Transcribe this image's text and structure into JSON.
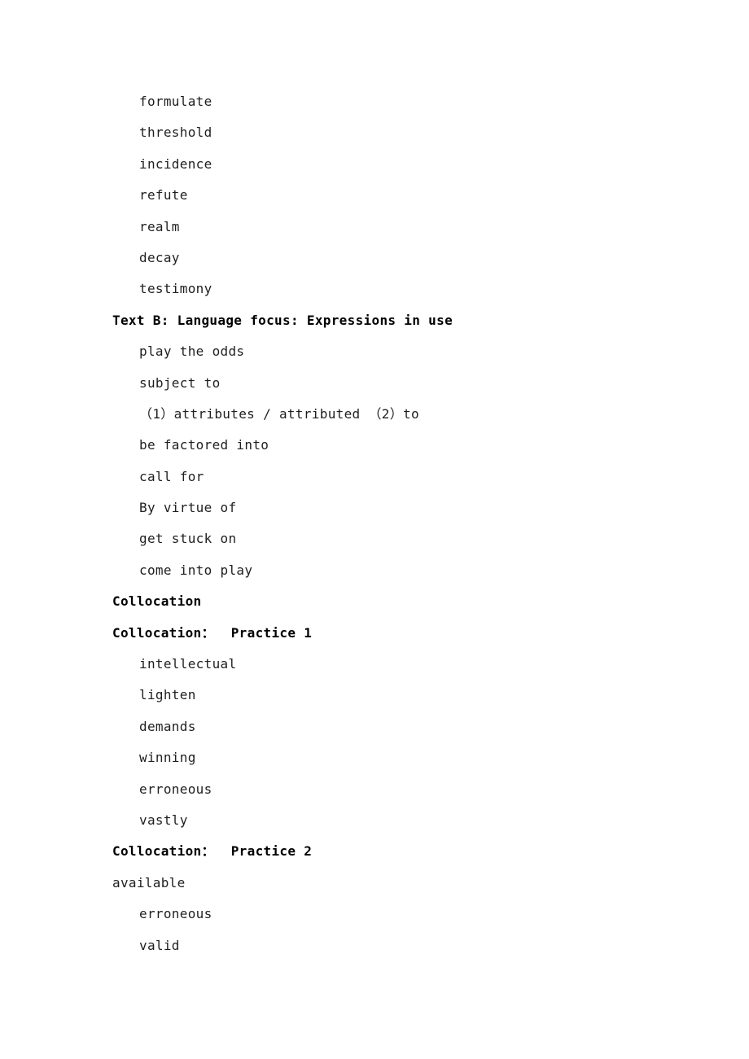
{
  "document": {
    "page_background": "#ffffff",
    "text_color": "#1f1f1f",
    "heading_color": "#000000",
    "blocks": [
      {
        "text": "formulate",
        "style": "indent"
      },
      {
        "text": "threshold",
        "style": "indent"
      },
      {
        "text": "incidence",
        "style": "indent"
      },
      {
        "text": "refute",
        "style": "indent"
      },
      {
        "text": "realm",
        "style": "indent"
      },
      {
        "text": "decay",
        "style": "indent"
      },
      {
        "text": "testimony",
        "style": "indent"
      },
      {
        "text": "Text B: Language focus: Expressions in use",
        "style": "heading"
      },
      {
        "text": "play the odds",
        "style": "indent"
      },
      {
        "text": "subject to",
        "style": "indent"
      },
      {
        "text": "（1）attributes / attributed （2）to",
        "style": "indent"
      },
      {
        "text": "be factored into",
        "style": "indent"
      },
      {
        "text": "call for",
        "style": "indent"
      },
      {
        "text": "By virtue of",
        "style": "indent"
      },
      {
        "text": "get stuck on",
        "style": "indent"
      },
      {
        "text": "come into play",
        "style": "indent"
      },
      {
        "text": "Collocation",
        "style": "heading"
      },
      {
        "text": "Collocation：  Practice 1",
        "style": "heading"
      },
      {
        "text": "intellectual",
        "style": "indent"
      },
      {
        "text": "lighten",
        "style": "indent"
      },
      {
        "text": "demands",
        "style": "indent"
      },
      {
        "text": "winning",
        "style": "indent"
      },
      {
        "text": "erroneous",
        "style": "indent"
      },
      {
        "text": "vastly",
        "style": "indent"
      },
      {
        "text": "Collocation：  Practice 2",
        "style": "heading"
      },
      {
        "text": "available",
        "style": "flush"
      },
      {
        "text": "erroneous",
        "style": "indent"
      },
      {
        "text": "valid",
        "style": "indent"
      }
    ]
  }
}
